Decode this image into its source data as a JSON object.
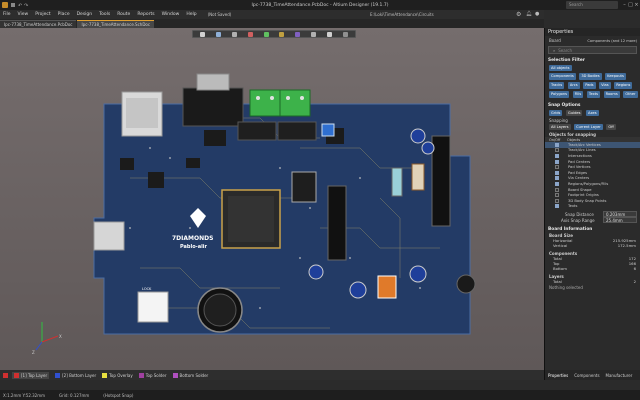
{
  "window": {
    "title": "Ipc-7738_TimeAttendance.PcbDoc - Altium Designer (19.1.7)",
    "search_placeholder": "Search"
  },
  "menu": {
    "items": [
      "File",
      "View",
      "Project",
      "Place",
      "Design",
      "Tools",
      "Route",
      "Reports",
      "Window",
      "Help"
    ],
    "not_saved": "(Not Saved)",
    "path": "E:\\Loki\\TimeAttendance\\Circuits"
  },
  "doc_tabs": [
    "Ipc-7738_TimeAttendance.PcbDoc",
    "Ipc-7738_TimeAttendance.SchDoc"
  ],
  "board": {
    "logo_text": "7DIAMONDS",
    "logo_sub": "Pablo-alir",
    "lock_label": "LOCK"
  },
  "layers": [
    {
      "label": "[1] Top Layer",
      "color": "#d03030",
      "active": true
    },
    {
      "label": "[2] Bottom Layer",
      "color": "#3050d0",
      "active": false
    },
    {
      "label": "Top Overlay",
      "color": "#e8e040",
      "active": false
    },
    {
      "label": "Top Solder",
      "color": "#a040a0",
      "active": false
    },
    {
      "label": "Bottom Solder",
      "color": "#b050c0",
      "active": false
    }
  ],
  "status": {
    "coords": "X:1.2mm Y:52.32mm",
    "grid": "Grid: 0.127mm",
    "mode": "(Hotspot Snap)"
  },
  "panel": {
    "title": "Properties",
    "board_label": "Board",
    "board_value": "Components (and 12 more)",
    "search_placeholder": "Search",
    "selection_filter": "Selection Filter",
    "all_objects": "All objects",
    "filter_buttons": [
      "Components",
      "3D Bodies",
      "Keepouts",
      "Tracks",
      "Arcs",
      "Pads",
      "Vias",
      "Regions",
      "Polygons",
      "Fills",
      "Texts",
      "Rooms",
      "Other"
    ],
    "snap_options": "Snap Options",
    "grid_buttons": [
      "Grids",
      "Guides",
      "Axes"
    ],
    "snapping_label": "Snapping",
    "snap_modes": [
      "All Layers",
      "Current Layer",
      "Off"
    ],
    "objects_for_snapping": "Objects for snapping",
    "snap_header": [
      "On/Off",
      "Objects"
    ],
    "snap_objects": [
      {
        "label": "Track/Arc Vertices",
        "on": true
      },
      {
        "label": "Track/Arc Lines",
        "on": false
      },
      {
        "label": "Intersections",
        "on": true
      },
      {
        "label": "Pad Centers",
        "on": true
      },
      {
        "label": "Pad Vertices",
        "on": false
      },
      {
        "label": "Pad Edges",
        "on": true
      },
      {
        "label": "Via Centers",
        "on": true
      },
      {
        "label": "Regions/Polygons/Fills",
        "on": true
      },
      {
        "label": "Board Shape",
        "on": false
      },
      {
        "label": "Footprint Origins",
        "on": false
      },
      {
        "label": "3D Body Snap Points",
        "on": false
      },
      {
        "label": "Texts",
        "on": true
      }
    ],
    "snap_distance_label": "Snap Distance",
    "snap_distance": "0.203mm",
    "axis_snap_label": "Axis Snap Range",
    "axis_snap": "25.4mm",
    "board_information": "Board Information",
    "board_size": "Board Size",
    "horizontal_label": "Horizontal",
    "horizontal": "215.925mm",
    "vertical_label": "Vertical",
    "vertical": "172.5mm",
    "components_label": "Components",
    "comp_counts": [
      {
        "k": "Total",
        "v": "172"
      },
      {
        "k": "Top",
        "v": "166"
      },
      {
        "k": "Bottom",
        "v": "6"
      }
    ],
    "layers_label": "Layers",
    "layers_total_label": "Total",
    "layers_total": "2",
    "nothing_selected": "Nothing selected",
    "bottom_tabs": [
      "Properties",
      "Components",
      "Manufacturer"
    ]
  },
  "colors": {
    "board": "#233b66",
    "canvas_top": "#756d6d",
    "accent": "#3f6b9a"
  }
}
